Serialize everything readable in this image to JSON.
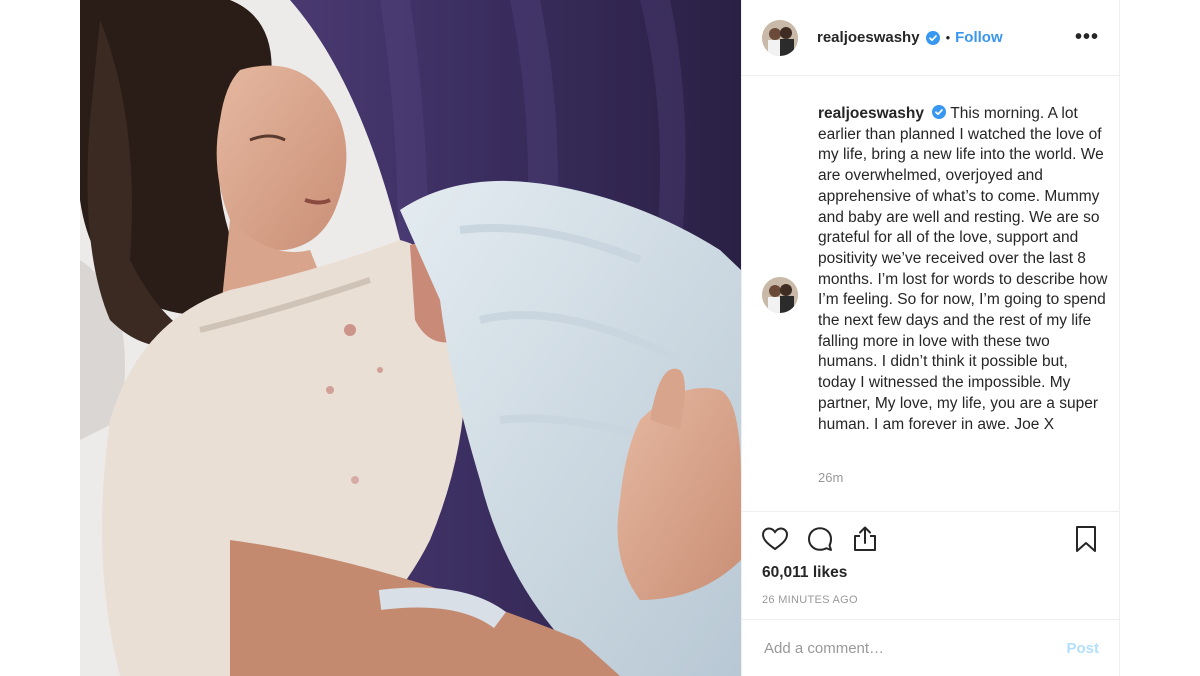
{
  "post": {
    "username": "realjoeswashy",
    "follow_label": "Follow",
    "more_label": "•••",
    "separator": "•",
    "caption_text": "This morning. A lot earlier than planned I watched the love of my life, bring a new life into the world. We are overwhelmed, overjoyed and apprehensive of what’s to come. Mummy and baby are well and resting. We are so grateful for all of the love, support and positivity we’ve received over the last 8 months. I’m lost for words to describe how I’m feeling. So for now, I’m going to spend the next few days and the rest of my life falling more in love with these two humans. I didn’t think it possible but, today I witnessed the impossible. My partner, My love, my life, you are a super human. I am forever in awe. Joe X",
    "caption_time": "26m",
    "likes": "60,011 likes",
    "time_ago": "26 MINUTES AGO",
    "comment_placeholder": "Add a comment…",
    "post_button": "Post"
  },
  "colors": {
    "link_blue": "#3897f0",
    "verified_blue": "#3897f0",
    "post_button_disabled": "#b2dffc",
    "secondary_text": "#999999",
    "border": "#efefef"
  },
  "icons": {
    "like": "heart-icon",
    "comment": "comment-icon",
    "share": "share-icon",
    "save": "bookmark-icon",
    "verified": "verified-badge-icon",
    "more": "more-options-icon"
  }
}
